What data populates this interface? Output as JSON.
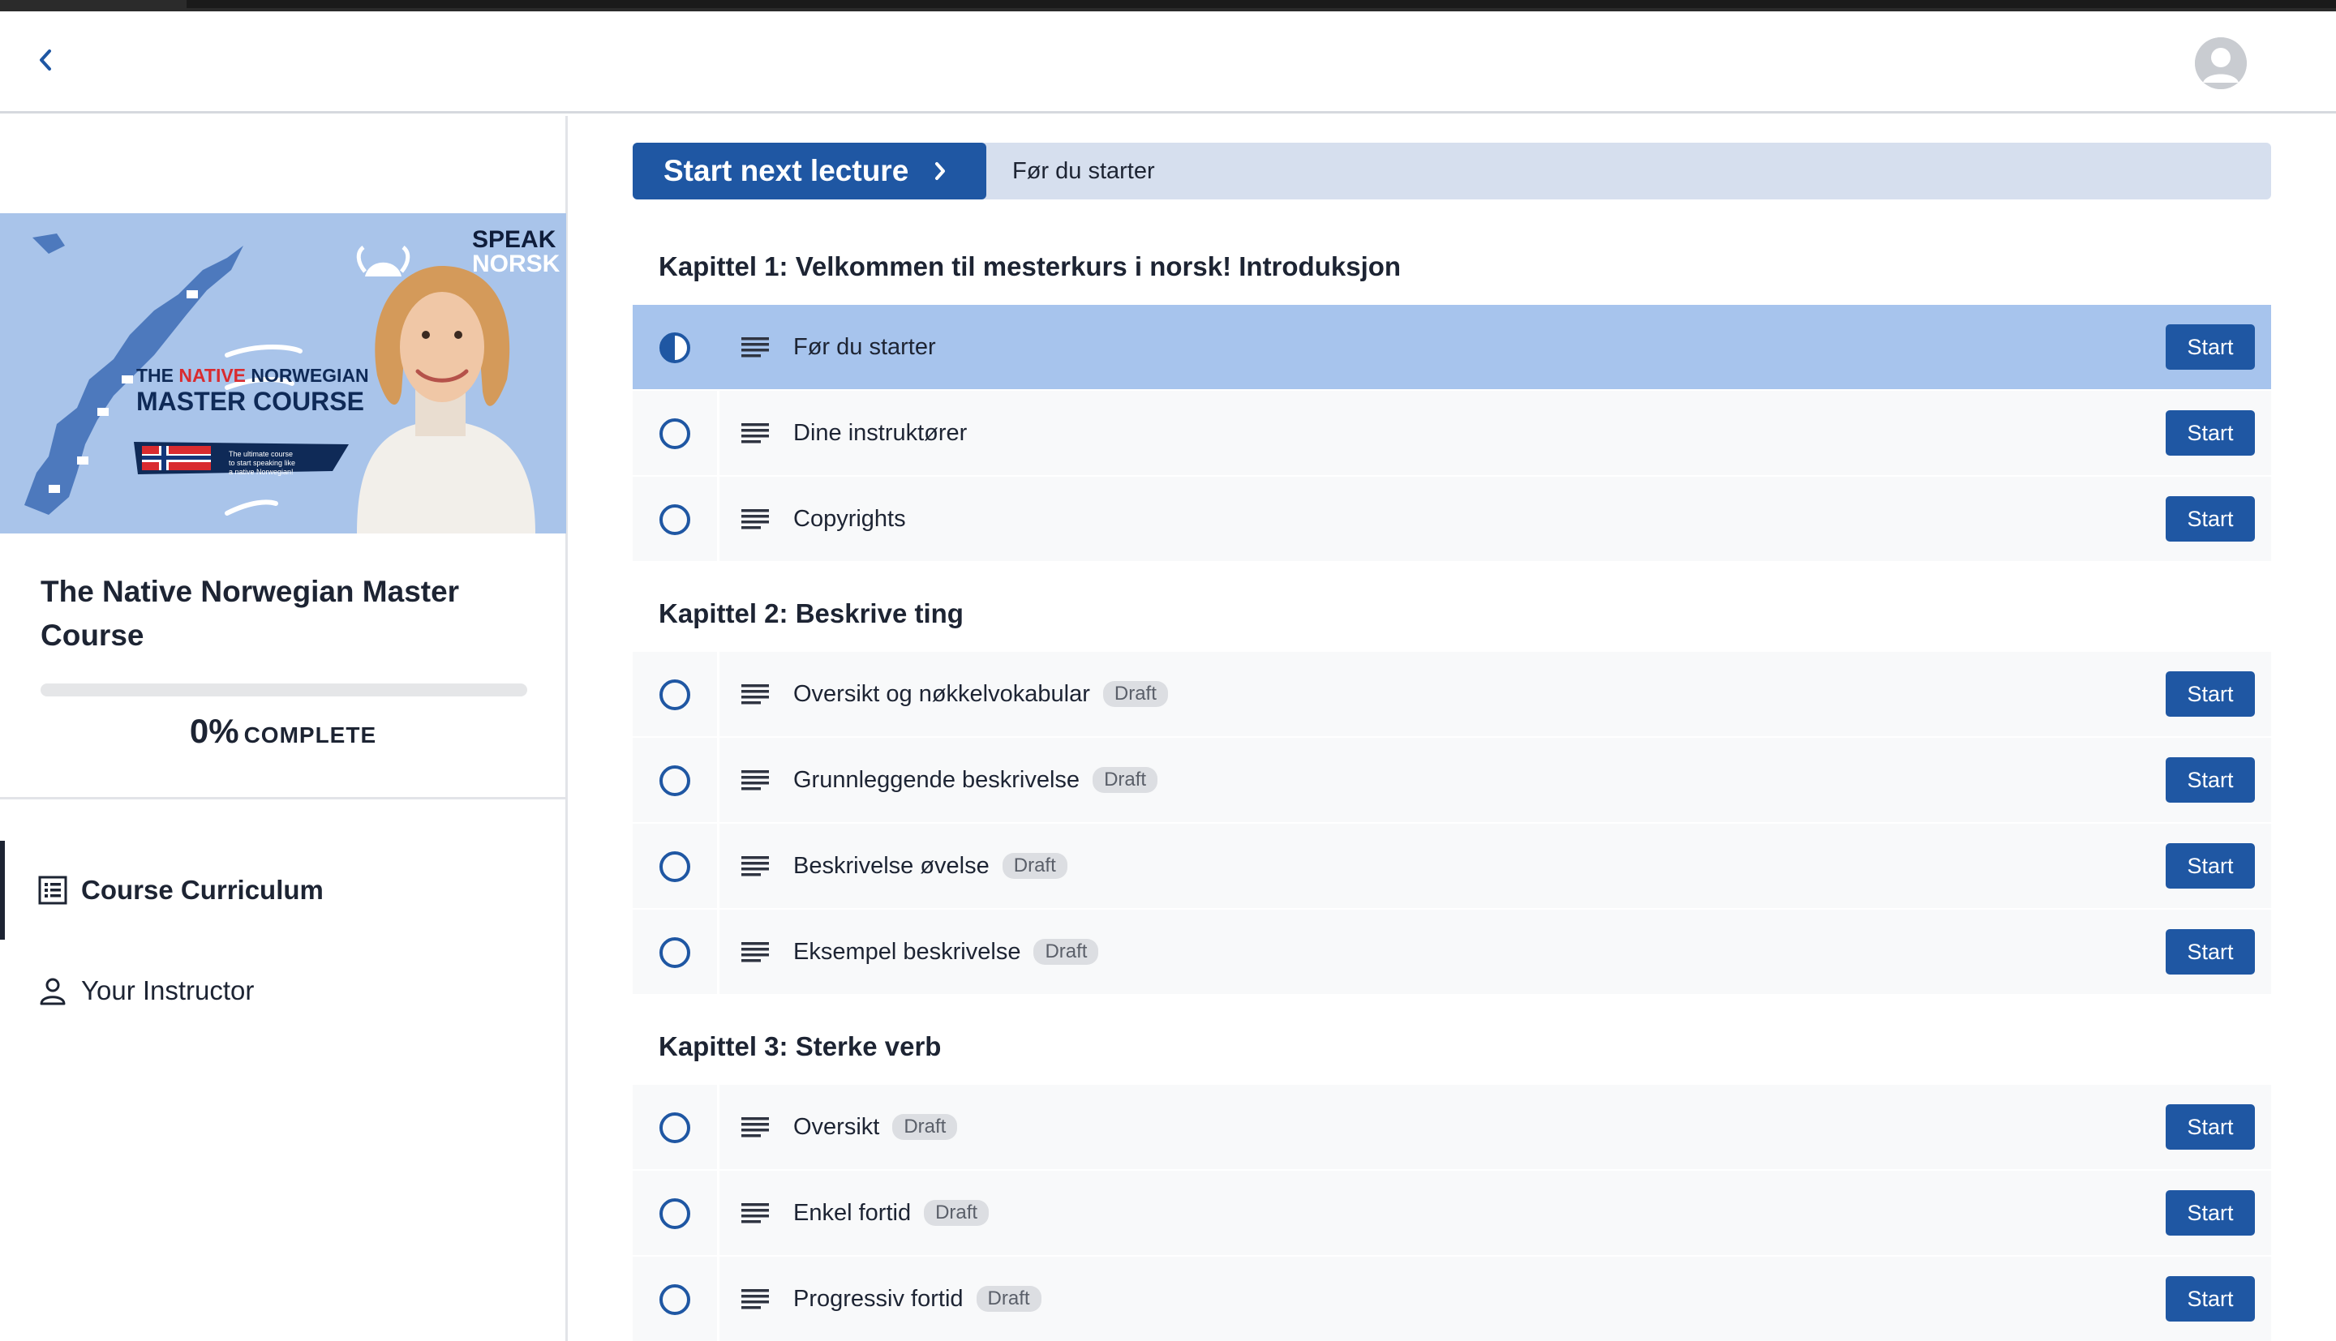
{
  "header": {
    "back_icon": "chevron-left-icon",
    "avatar_icon": "user-avatar-icon"
  },
  "sidebar": {
    "thumbnail": {
      "brand_top": "SPEAK",
      "brand_bottom": "NORSK",
      "line1_pre": "THE ",
      "line1_accent": "NATIVE",
      "line1_post": " NORWEGIAN",
      "line2": "MASTER COURSE",
      "tagline_1": "The ultimate course",
      "tagline_2": "to start speaking like",
      "tagline_3": "a native Norwegian!"
    },
    "course_title": "The Native Norwegian Master Course",
    "progress": {
      "value": 0,
      "percent_label": "0%",
      "complete_label": "COMPLETE"
    },
    "nav": [
      {
        "label": "Course Curriculum",
        "icon": "list-icon",
        "active": true
      },
      {
        "label": "Your Instructor",
        "icon": "person-icon",
        "active": false
      }
    ]
  },
  "next_lecture": {
    "button_label": "Start next lecture",
    "lecture_title": "Før du starter"
  },
  "colors": {
    "accent": "#1f57a3",
    "current_row": "#a7c4ed",
    "next_bar": "#d6dfee"
  },
  "chapters": [
    {
      "title": "Kapittel 1: Velkommen til mesterkurs i norsk! Introduksjon",
      "lectures": [
        {
          "title": "Før du starter",
          "draft": "",
          "status": "in-progress",
          "button": "Start"
        },
        {
          "title": "Dine instruktører",
          "draft": "",
          "status": "not-started",
          "button": "Start"
        },
        {
          "title": "Copyrights",
          "draft": "",
          "status": "not-started",
          "button": "Start"
        }
      ]
    },
    {
      "title": "Kapittel 2: Beskrive ting",
      "lectures": [
        {
          "title": "Oversikt og nøkkelvokabular",
          "draft": "Draft",
          "status": "not-started",
          "button": "Start"
        },
        {
          "title": "Grunnleggende beskrivelse",
          "draft": "Draft",
          "status": "not-started",
          "button": "Start"
        },
        {
          "title": "Beskrivelse øvelse",
          "draft": "Draft",
          "status": "not-started",
          "button": "Start"
        },
        {
          "title": "Eksempel beskrivelse",
          "draft": "Draft",
          "status": "not-started",
          "button": "Start"
        }
      ]
    },
    {
      "title": "Kapittel 3: Sterke verb",
      "lectures": [
        {
          "title": "Oversikt",
          "draft": "Draft",
          "status": "not-started",
          "button": "Start"
        },
        {
          "title": "Enkel fortid",
          "draft": "Draft",
          "status": "not-started",
          "button": "Start"
        },
        {
          "title": "Progressiv fortid",
          "draft": "Draft",
          "status": "not-started",
          "button": "Start"
        }
      ]
    }
  ]
}
